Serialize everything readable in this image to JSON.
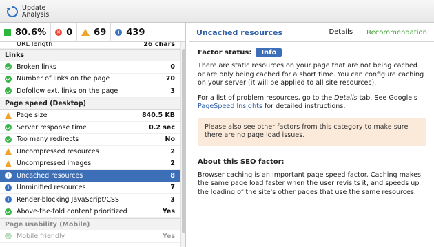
{
  "toolbar": {
    "update_label": "Update\nAnalysis"
  },
  "summary": {
    "score": "80.6%",
    "errors": "0",
    "warnings": "69",
    "info": "439"
  },
  "list": {
    "cut_top": {
      "label": "URL length",
      "value": "26 chars"
    },
    "sections": [
      {
        "title": "Links",
        "items": [
          {
            "status": "ok",
            "label": "Broken links",
            "value": "0"
          },
          {
            "status": "ok",
            "label": "Number of links on the page",
            "value": "70"
          },
          {
            "status": "ok",
            "label": "Dofollow ext. links on the page",
            "value": "3"
          }
        ]
      },
      {
        "title": "Page speed (Desktop)",
        "items": [
          {
            "status": "warn",
            "label": "Page size",
            "value": "840.5 KB"
          },
          {
            "status": "ok",
            "label": "Server response time",
            "value": "0.2 sec"
          },
          {
            "status": "ok",
            "label": "Too many redirects",
            "value": "No"
          },
          {
            "status": "warn",
            "label": "Uncompressed resources",
            "value": "2"
          },
          {
            "status": "warn",
            "label": "Uncompressed images",
            "value": "2"
          },
          {
            "status": "info",
            "label": "Uncached resources",
            "value": "8",
            "selected": true
          },
          {
            "status": "info",
            "label": "Unminified resources",
            "value": "7"
          },
          {
            "status": "info",
            "label": "Render-blocking JavaScript/CSS",
            "value": "3"
          },
          {
            "status": "ok",
            "label": "Above-the-fold content prioritized",
            "value": "Yes"
          }
        ]
      }
    ],
    "faded_section": {
      "title": "Page usability (Mobile)"
    },
    "faded_item": {
      "label": "Mobile friendly",
      "value": "Yes"
    }
  },
  "detail": {
    "title": "Uncached resources",
    "tab_details": "Details",
    "tab_recommendation": "Recommendation",
    "status_label": "Factor status:",
    "status_value": "Info",
    "para1": "There are static resources on your page that are not being cached or are only being cached for a short time. You can configure caching on your server (it will be applied to all site resources).",
    "para2_a": "For a list of problem resources, go to the ",
    "para2_em": "Details",
    "para2_b": " tab. See Google's ",
    "para2_link": "PageSpeed Insights",
    "para2_c": " for detailed instructions.",
    "notice": "Please also see other factors from this category to make sure there are no page load issues.",
    "about_title": "About this SEO factor:",
    "about_text": "Browser caching is an important page speed factor. Caching makes the same page load faster when the user revisits it, and speeds up the loading of the site's other pages that use the same resources."
  }
}
